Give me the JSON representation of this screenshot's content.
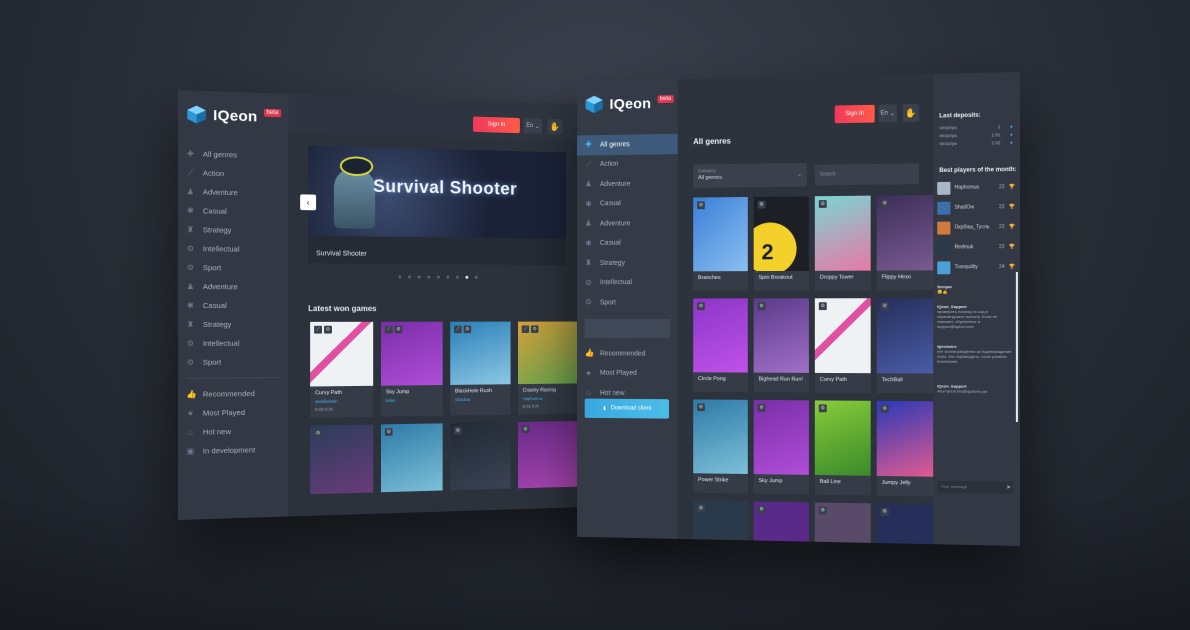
{
  "brand": {
    "name": "IQeon",
    "beta": "beta"
  },
  "header": {
    "signin": "Sign In",
    "lang": "En",
    "lang_chevron": "⌄",
    "account_icon": "hand-icon"
  },
  "back_nav": [
    {
      "label": "All genres",
      "icon": "gamepad-icon"
    },
    {
      "label": "Action",
      "icon": "sword-icon"
    },
    {
      "label": "Adventure",
      "icon": "compass-icon"
    },
    {
      "label": "Casual",
      "icon": "puzzle-icon"
    },
    {
      "label": "Strategy",
      "icon": "chess-icon"
    },
    {
      "label": "Intellectual",
      "icon": "brain-icon"
    },
    {
      "label": "Sport",
      "icon": "ball-icon"
    },
    {
      "label": "Adventure",
      "icon": "compass-icon"
    },
    {
      "label": "Casual",
      "icon": "puzzle-icon"
    },
    {
      "label": "Strategy",
      "icon": "chess-icon"
    },
    {
      "label": "Intellectual",
      "icon": "brain-icon"
    },
    {
      "label": "Sport",
      "icon": "ball-icon"
    }
  ],
  "back_nav2": [
    {
      "label": "Recommended",
      "icon": "thumbs-up-icon"
    },
    {
      "label": "Most Played",
      "icon": "star-icon"
    },
    {
      "label": "Hot new",
      "icon": "fire-icon"
    },
    {
      "label": "In development",
      "icon": "tools-icon"
    }
  ],
  "hero": {
    "title": "Survival Shooter",
    "caption": "Survival Shooter",
    "prev": "‹",
    "next": "›"
  },
  "latest_title": "Latest won games",
  "latest_games": [
    {
      "name": "Curvy Path",
      "user": "steelbolt4in",
      "price": "0.03 ICN"
    },
    {
      "name": "Sky Jump",
      "user": "lvilixi",
      "price": ""
    },
    {
      "name": "BlackHole Rush",
      "user": "Shadow",
      "price": ""
    },
    {
      "name": "Crashy Racing",
      "user": "Haphomus",
      "price": "0.02 ICN"
    }
  ],
  "front_nav": [
    {
      "label": "All genres",
      "icon": "gamepad-icon"
    },
    {
      "label": "Action",
      "icon": "sword-icon"
    },
    {
      "label": "Adventure",
      "icon": "compass-icon"
    },
    {
      "label": "Casual",
      "icon": "puzzle-icon"
    },
    {
      "label": "Adventure",
      "icon": "compass-icon"
    },
    {
      "label": "Casual",
      "icon": "puzzle-icon"
    },
    {
      "label": "Strategy",
      "icon": "chess-icon"
    },
    {
      "label": "Intellectual",
      "icon": "brain-icon"
    },
    {
      "label": "Sport",
      "icon": "ball-icon"
    }
  ],
  "front_nav2": [
    {
      "label": "Recommended",
      "icon": "thumbs-up-icon"
    },
    {
      "label": "Most Played",
      "icon": "star-icon"
    },
    {
      "label": "Hot new",
      "icon": "fire-icon"
    },
    {
      "label": "In development",
      "icon": "tools-icon"
    }
  ],
  "download": "Download client",
  "main": {
    "title": "All genres",
    "category_label": "Category",
    "category_value": "All genres",
    "search_placeholder": "Search"
  },
  "grid": [
    {
      "name": "Branches"
    },
    {
      "name": "Spin Breakout"
    },
    {
      "name": "Droppy Tower"
    },
    {
      "name": "Flippy Hexo"
    },
    {
      "name": "Circle Pong"
    },
    {
      "name": "Bighead Run Run!"
    },
    {
      "name": "Curvy Path"
    },
    {
      "name": "TechBall"
    },
    {
      "name": "Power Strike"
    },
    {
      "name": "Sky Jump"
    },
    {
      "name": "Ball Line"
    },
    {
      "name": "Jumpy Jelly"
    }
  ],
  "spin_number": "2",
  "right": {
    "deposits_title": "Last deposits:",
    "deposits": [
      {
        "name": "Victoriya",
        "amount": "2"
      },
      {
        "name": "Victoriya",
        "amount": "1.81"
      },
      {
        "name": "Victoriya",
        "amount": "2.02"
      }
    ],
    "best_title": "Best players of the month:",
    "best": [
      {
        "name": "Haphomus",
        "score": "22"
      },
      {
        "name": "ShadOw",
        "score": "22"
      },
      {
        "name": "Окрбяш_Тусль",
        "score": "22"
      },
      {
        "name": "Redmuk",
        "score": "22"
      },
      {
        "name": "Tranquility",
        "score": "24"
      }
    ],
    "chat": [
      {
        "user": "Sempai",
        "text": "😊👍"
      },
      {
        "user": "IQeon_Support",
        "text": "проверить почему-то код и перезагрузите проекту. Если не поможет, обратитесь в support@iqeon.com"
      },
      {
        "user": "Ignorance",
        "text": "нет вознаграждения за подтверждение игры, как подтвердить, если узнайте, возникшие"
      },
      {
        "user": "IQeon_Support",
        "text": "Ana=prem bio@qualom par"
      }
    ],
    "chat_placeholder": "Your message",
    "send": "➤"
  }
}
